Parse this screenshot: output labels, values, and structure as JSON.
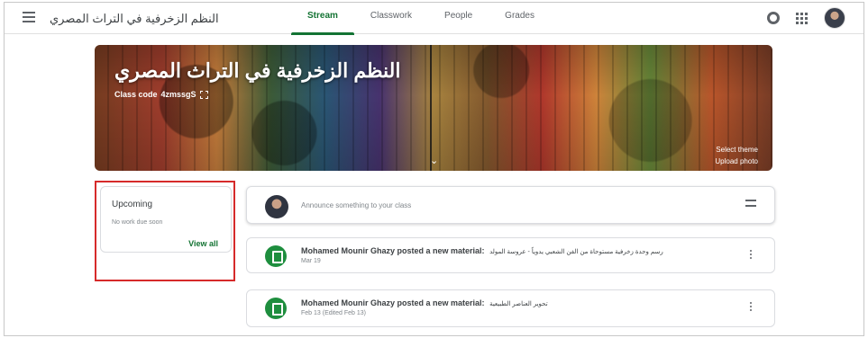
{
  "header": {
    "app_title": "النظم الزخرفية في التراث المصري",
    "tabs": [
      {
        "label": "Stream",
        "active": true
      },
      {
        "label": "Classwork",
        "active": false
      },
      {
        "label": "People",
        "active": false
      },
      {
        "label": "Grades",
        "active": false
      }
    ],
    "icons": [
      "menu-icon",
      "gear-icon",
      "apps-grid-icon",
      "avatar"
    ]
  },
  "banner": {
    "title": "النظم الزخرفية في التراث المصري",
    "class_code_label": "Class code",
    "class_code": "4zmssgS",
    "select_theme": "Select theme",
    "upload_photo": "Upload photo"
  },
  "upcoming": {
    "title": "Upcoming",
    "subtitle": "No work due soon",
    "link": "View all"
  },
  "announce": {
    "placeholder": "Announce something to your class"
  },
  "posts": [
    {
      "author": "Mohamed Mounir Ghazy posted a new material:",
      "material": "رسم وحدة زخرفية مستوحاة من الفن الشعبي يدوياً - عروسة المولد",
      "date": "Mar 19"
    },
    {
      "author": "Mohamed Mounir Ghazy posted a new material:",
      "material": "تحوير العناصر الطبيعية",
      "date": "Feb 13 (Edited Feb 13)"
    }
  ],
  "colors": {
    "accent": "#137333",
    "material_icon": "#1e8e3e",
    "highlight_box": "#d62a2a"
  }
}
